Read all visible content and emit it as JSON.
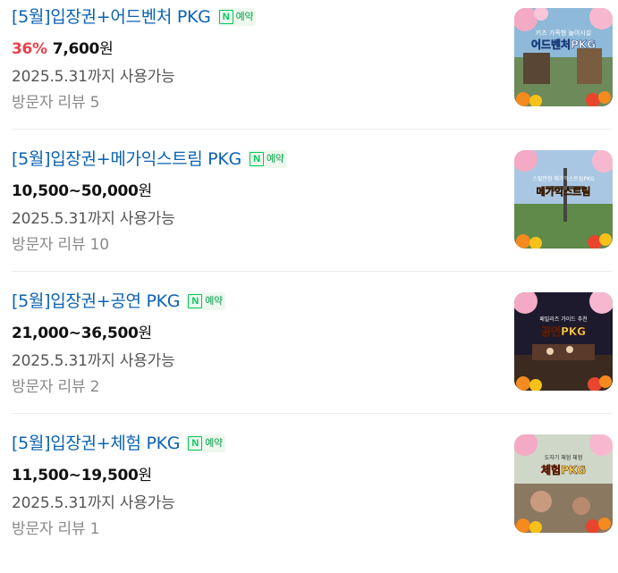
{
  "reservation_badge": {
    "icon": "naver-n-icon",
    "label": "예약",
    "color": "#03c75a"
  },
  "items": [
    {
      "title": "[5월]입장권+어드벤처 PKG",
      "discount": "36%",
      "price": "7,600",
      "currency": "원",
      "validity": "2025.5.31까지 사용가능",
      "review": "방문자 리뷰 5",
      "thumb_caption": "키즈 가족형 놀이시설",
      "thumb_title": "어드벤처PKG"
    },
    {
      "title": "[5월]입장권+메가익스트림 PKG",
      "discount": "",
      "price": "10,500~50,000",
      "currency": "원",
      "validity": "2025.5.31까지 사용가능",
      "review": "방문자 리뷰 10",
      "thumb_caption": "스릴만점 메가익스트림PKG",
      "thumb_title": "메가익스트림"
    },
    {
      "title": "[5월]입장권+공연 PKG",
      "discount": "",
      "price": "21,000~36,500",
      "currency": "원",
      "validity": "2025.5.31까지 사용가능",
      "review": "방문자 리뷰 2",
      "thumb_caption": "패밀리즈 가이드 추천",
      "thumb_title": "공연PKG"
    },
    {
      "title": "[5월]입장권+체험 PKG",
      "discount": "",
      "price": "11,500~19,500",
      "currency": "원",
      "validity": "2025.5.31까지 사용가능",
      "review": "방문자 리뷰 1",
      "thumb_caption": "도자기 체험 체험",
      "thumb_title": "체험PKG"
    }
  ]
}
